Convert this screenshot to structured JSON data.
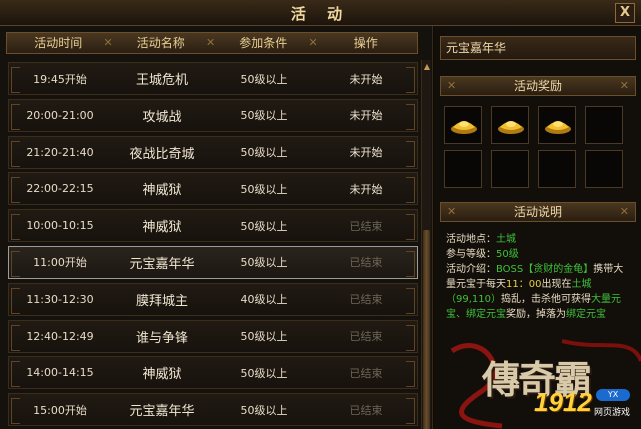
{
  "window": {
    "title": "活 动",
    "close_label": "X"
  },
  "table": {
    "headers": [
      "活动时间",
      "活动名称",
      "参加条件",
      "操作"
    ],
    "rows": [
      {
        "time": "19:45开始",
        "name": "王城危机",
        "condition": "50级以上",
        "status": "未开始",
        "ended": false
      },
      {
        "time": "20:00-21:00",
        "name": "攻城战",
        "condition": "50级以上",
        "status": "未开始",
        "ended": false
      },
      {
        "time": "21:20-21:40",
        "name": "夜战比奇城",
        "condition": "50级以上",
        "status": "未开始",
        "ended": false
      },
      {
        "time": "22:00-22:15",
        "name": "神威狱",
        "condition": "50级以上",
        "status": "未开始",
        "ended": false
      },
      {
        "time": "10:00-10:15",
        "name": "神威狱",
        "condition": "50级以上",
        "status": "已结束",
        "ended": true
      },
      {
        "time": "11:00开始",
        "name": "元宝嘉年华",
        "condition": "50级以上",
        "status": "已结束",
        "ended": true,
        "selected": true
      },
      {
        "time": "11:30-12:30",
        "name": "膜拜城主",
        "condition": "40级以上",
        "status": "已结束",
        "ended": true
      },
      {
        "time": "12:40-12:49",
        "name": "谁与争锋",
        "condition": "50级以上",
        "status": "已结束",
        "ended": true
      },
      {
        "time": "14:00-14:15",
        "name": "神威狱",
        "condition": "50级以上",
        "status": "已结束",
        "ended": true
      },
      {
        "time": "15:00开始",
        "name": "元宝嘉年华",
        "condition": "50级以上",
        "status": "已结束",
        "ended": true
      }
    ]
  },
  "detail": {
    "selected_name": "元宝嘉年华",
    "reward_title": "活动奖励",
    "reward_slots": [
      "gold-ingot",
      "gold-ingot",
      "gold-ingot",
      "",
      "",
      "",
      "",
      ""
    ],
    "desc_title": "活动说明",
    "location_label": "活动地点：",
    "location_value": "土城",
    "level_label": "参与等级：",
    "level_value": "50级",
    "intro_label": "活动介绍：",
    "intro_boss": "BOSS【贪财的金龟】",
    "intro_text_1": "携带大量元宝于每天",
    "intro_time": "11：00",
    "intro_text_2": "出现在",
    "intro_place": "土城（99,110）",
    "intro_text_3": "捣乱，击杀他可获得",
    "intro_reward": "大量元宝、绑定元宝",
    "intro_text_4": "奖励，掉落为",
    "intro_text_5": "绑定元宝"
  },
  "branding": {
    "logo": "傳奇霸",
    "number": "1912",
    "badge": "YX",
    "sub": "网页游戏"
  },
  "colors": {
    "green": "#3fc23a",
    "yellow": "#e8d04a",
    "gold": "#ffd23a"
  }
}
